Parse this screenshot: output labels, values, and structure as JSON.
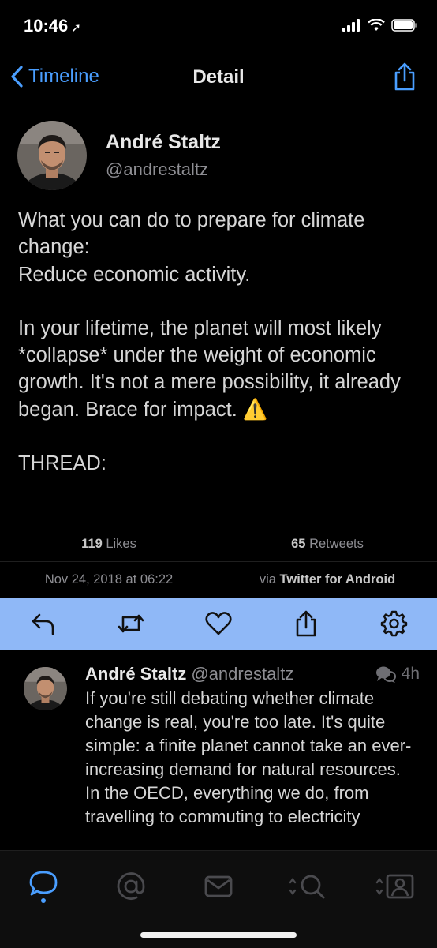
{
  "status_bar": {
    "time": "10:46",
    "location_icon": "location-arrow-icon",
    "icons": [
      "cellular-signal-icon",
      "wifi-icon",
      "battery-icon"
    ]
  },
  "nav": {
    "back_label": "Timeline",
    "title": "Detail",
    "share_icon": "share-icon"
  },
  "tweet": {
    "author_name": "André Staltz",
    "author_handle": "@andrestaltz",
    "text_lines": [
      "What you can do to prepare for climate change:",
      "Reduce economic activity.",
      "In your lifetime, the planet will most likely *collapse* under the weight of economic growth. It's not a mere possibility, it already began. Brace for impact.",
      "THREAD:"
    ],
    "emoji": "⚠️",
    "likes_count": "119",
    "likes_label": "Likes",
    "retweets_count": "65",
    "retweets_label": "Retweets",
    "timestamp": "Nov 24, 2018 at 06:22",
    "via_label": "via",
    "client": "Twitter for Android"
  },
  "actions": [
    "reply-icon",
    "retweet-icon",
    "like-heart-icon",
    "share-icon",
    "settings-gear-icon"
  ],
  "reply": {
    "author_name": "André Staltz",
    "author_handle": "@andrestaltz",
    "time": "4h",
    "text": "If you're still debating whether climate change is real, you're too late. It's quite simple: a finite planet cannot take an ever-increasing demand for natural resources. In the OECD, everything we do, from travelling to commuting to electricity"
  },
  "tab_bar": {
    "tabs": [
      "conversations-icon",
      "mentions-icon",
      "messages-icon",
      "search-icon",
      "profile-icon"
    ],
    "active_tab": "conversations-icon"
  },
  "colors": {
    "accent": "#4a9eff",
    "action_bar": "#8fb8f7",
    "background": "#000000"
  }
}
